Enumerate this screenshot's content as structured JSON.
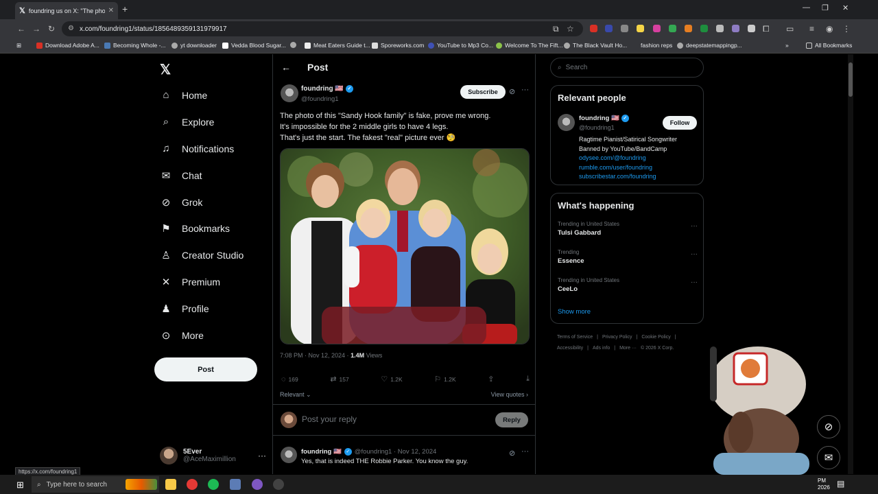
{
  "browser": {
    "tab_title": "foundring us on X: \"The photo",
    "url": "x.com/foundring1/status/1856489359131979917",
    "bookmarks": [
      "Download Adobe A...",
      "Becoming Whole -...",
      "yt downloader",
      "Vedda Blood Sugar...",
      "",
      "Meat Eaters Guide t...",
      "Sporeworks.com",
      "YouTube to Mp3 Co...",
      "Welcome To The Fift...",
      "The Black Vault Ho...",
      "fashion reps",
      "deepstatemappingp..."
    ],
    "all_bookmarks": "All Bookmarks",
    "status_url": "https://x.com/foundring1"
  },
  "nav": {
    "items": [
      {
        "label": "Home",
        "icon": "home-icon"
      },
      {
        "label": "Explore",
        "icon": "search-icon"
      },
      {
        "label": "Notifications",
        "icon": "bell-icon"
      },
      {
        "label": "Chat",
        "icon": "mail-icon"
      },
      {
        "label": "Grok",
        "icon": "grok-icon"
      },
      {
        "label": "Bookmarks",
        "icon": "bookmark-icon"
      },
      {
        "label": "Creator Studio",
        "icon": "creator-icon"
      },
      {
        "label": "Premium",
        "icon": "x-icon"
      },
      {
        "label": "Profile",
        "icon": "person-icon"
      },
      {
        "label": "More",
        "icon": "more-icon"
      }
    ],
    "post_button": "Post",
    "account": {
      "name": "5Ever",
      "handle": "@AceMaximillion"
    }
  },
  "post": {
    "header": "Post",
    "author_name": "foundring 🇺🇸",
    "author_handle": "@foundring1",
    "subscribe_label": "Subscribe",
    "text_lines": [
      "The photo of this \"Sandy Hook family\" is fake, prove me wrong.",
      "It's impossible for the 2 middle girls to have 4 legs.",
      "That's just the start. The fakest \"real\" picture ever 🧐"
    ],
    "time": "7:08 PM · Nov 12, 2024 · ",
    "views_count": "1.4M",
    "views_label": " Views",
    "replies": "169",
    "reposts": "157",
    "likes": "1.2K",
    "bookmarks": "1.2K",
    "relevant_label": "Relevant",
    "view_quotes_label": "View quotes",
    "reply_placeholder": "Post your reply",
    "reply_button": "Reply"
  },
  "reply": {
    "name": "foundring 🇺🇸",
    "handle_date": "@foundring1 · Nov 12, 2024",
    "text": "Yes, that is indeed THE Robbie Parker. You know the guy."
  },
  "right": {
    "search_placeholder": "Search",
    "relevant_people_title": "Relevant people",
    "person": {
      "name": "foundring 🇺🇸",
      "handle": "@foundring1",
      "follow_label": "Follow",
      "bio_line1": "Ragtime Pianist/Satirical Songwriter",
      "bio_line2": "Banned by YouTube/BandCamp",
      "links": [
        "odysee.com/@foundring",
        "rumble.com/user/foundring",
        "subscribestar.com/foundring"
      ]
    },
    "happening_title": "What's happening",
    "trends": [
      {
        "context": "Trending in United States",
        "name": "Tulsi Gabbard"
      },
      {
        "context": "Trending",
        "name": "Essence"
      },
      {
        "context": "Trending in United States",
        "name": "CeeLo"
      }
    ],
    "show_more": "Show more",
    "footer_line1": [
      "Terms of Service",
      "|",
      "Privacy Policy",
      "|",
      "Cookie Policy",
      "|"
    ],
    "footer_line2": [
      "Accessibility",
      "|",
      "Ads info",
      "|",
      "More ···",
      "© 2026 X Corp."
    ]
  },
  "taskbar": {
    "search_placeholder": "Type here to search",
    "time": "PM",
    "date": "2026"
  },
  "colors": {
    "accent": "#1d9bf0",
    "background": "#000000",
    "border": "#2f3336",
    "muted": "#71767b"
  }
}
